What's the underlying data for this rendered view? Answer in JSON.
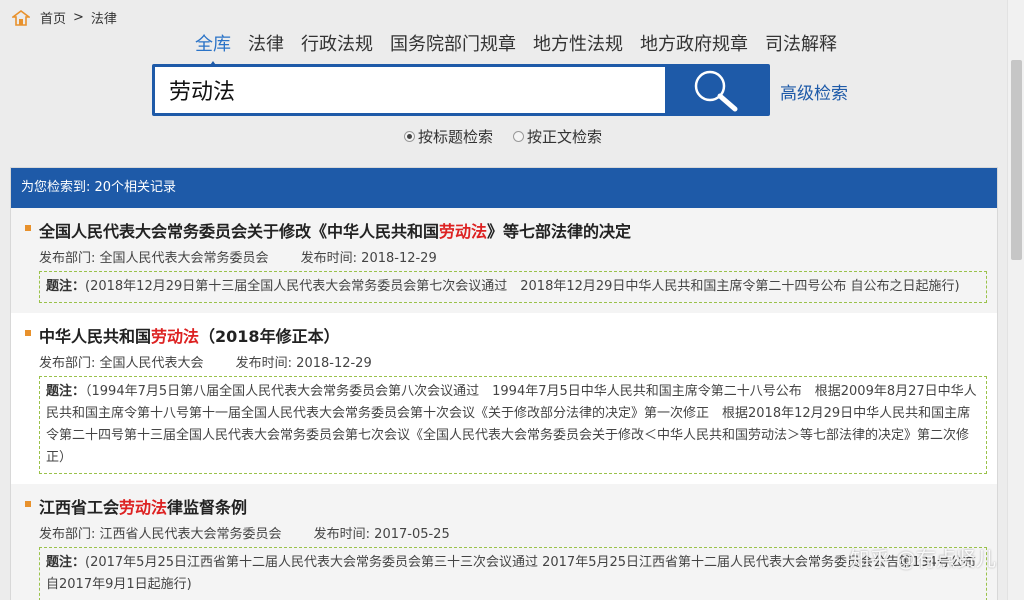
{
  "breadcrumb": {
    "home": "首页",
    "separator": ">",
    "current": "法律"
  },
  "tabs": [
    "全库",
    "法律",
    "行政法规",
    "国务院部门规章",
    "地方性法规",
    "地方政府规章",
    "司法解释"
  ],
  "search": {
    "value": "劳动法",
    "advanced": "高级检索"
  },
  "radio_options": [
    {
      "label": "按标题检索",
      "checked": true
    },
    {
      "label": "按正文检索",
      "checked": false
    }
  ],
  "results_header": "为您检索到: 20个相关记录",
  "results": [
    {
      "title_pre": "全国人民代表大会常务委员会关于修改《中华人民共和国",
      "title_hl": "劳动法",
      "title_post": "》等七部法律的决定",
      "dept": "发布部门: 全国人民代表大会常务委员会",
      "date": "发布时间: 2018-12-29",
      "note_label": "题注：",
      "note": "(2018年12月29日第十三届全国人民代表大会常务委员会第七次会议通过　2018年12月29日中华人民共和国主席令第二十四号公布 自公布之日起施行)"
    },
    {
      "title_pre": "中华人民共和国",
      "title_hl": "劳动法",
      "title_post": "（2018年修正本）",
      "dept": "发布部门: 全国人民代表大会",
      "date": "发布时间: 2018-12-29",
      "note_label": "题注：",
      "note": "（1994年7月5日第八届全国人民代表大会常务委员会第八次会议通过　1994年7月5日中华人民共和国主席令第二十八号公布　根据2009年8月27日中华人民共和国主席令第十八号第十一届全国人民代表大会常务委员会第十次会议《关于修改部分法律的决定》第一次修正　根据2018年12月29日中华人民共和国主席令第二十四号第十三届全国人民代表大会常务委员会第七次会议《全国人民代表大会常务委员会关于修改＜中华人民共和国劳动法＞等七部法律的决定》第二次修正）"
    },
    {
      "title_pre": "江西省工会",
      "title_hl": "劳动法",
      "title_post": "律监督条例",
      "dept": "发布部门: 江西省人民代表大会常务委员会",
      "date": "发布时间: 2017-05-25",
      "note_label": "题注：",
      "note": "(2017年5月25日江西省第十二届人民代表大会常务委员会第三十三次会议通过 2017年5月25日江西省第十二届人民代表大会常务委员会公告第134号公布 自2017年9月1日起施行)"
    }
  ],
  "watermark": "知乎 @有点贤儿",
  "colors": {
    "primary": "#1e5aa8",
    "highlight": "#dd2222",
    "bullet": "#e8912c"
  }
}
